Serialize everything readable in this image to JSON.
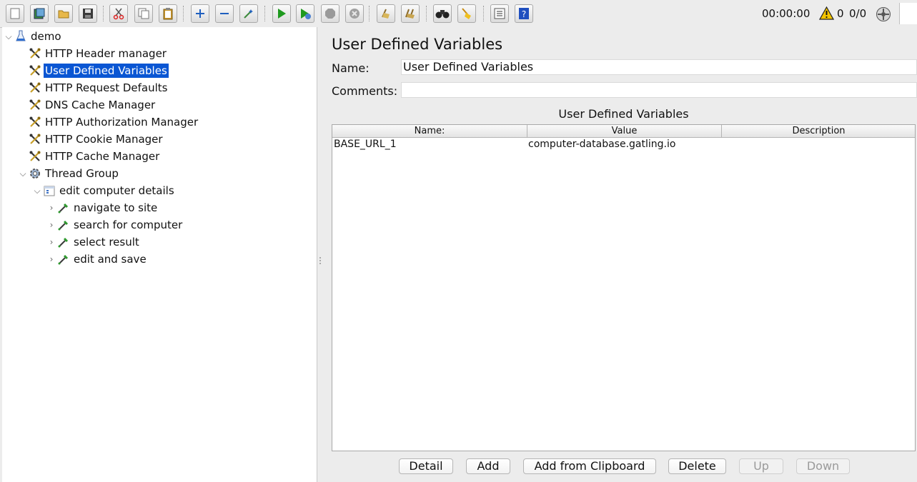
{
  "toolbar": {
    "buttons": [
      {
        "name": "new",
        "icon": "new-document-icon"
      },
      {
        "name": "templates",
        "icon": "templates-icon"
      },
      {
        "name": "open",
        "icon": "open-folder-icon"
      },
      {
        "name": "save",
        "icon": "save-disk-icon"
      },
      {
        "name": "cut",
        "icon": "scissors-icon"
      },
      {
        "name": "copy",
        "icon": "copy-icon"
      },
      {
        "name": "paste",
        "icon": "clipboard-icon"
      },
      {
        "name": "expand-all",
        "icon": "plus-icon"
      },
      {
        "name": "collapse-all",
        "icon": "minus-icon"
      },
      {
        "name": "toggle",
        "icon": "wand-icon"
      },
      {
        "name": "start",
        "icon": "play-icon"
      },
      {
        "name": "start-no-pauses",
        "icon": "play-timer-icon"
      },
      {
        "name": "stop",
        "icon": "stop-icon"
      },
      {
        "name": "shutdown",
        "icon": "shutdown-icon"
      },
      {
        "name": "clear",
        "icon": "broom-clear-icon"
      },
      {
        "name": "clear-all",
        "icon": "broom-clear-all-icon"
      },
      {
        "name": "search",
        "icon": "binoculars-icon"
      },
      {
        "name": "reset-search",
        "icon": "broom-icon"
      },
      {
        "name": "function-helper",
        "icon": "list-icon"
      },
      {
        "name": "help",
        "icon": "help-icon"
      }
    ],
    "elapsed_time": "00:00:00",
    "warning_count": "0",
    "threads": "0/0"
  },
  "tree": {
    "root": "demo",
    "config_items": [
      "HTTP Header manager",
      "User Defined Variables",
      "HTTP Request Defaults",
      "DNS Cache Manager",
      "HTTP Authorization Manager",
      "HTTP Cookie Manager",
      "HTTP Cache Manager"
    ],
    "selected_index": 1,
    "thread_group": "Thread Group",
    "controller": "edit computer details",
    "samplers": [
      "navigate to site",
      "search for computer",
      "select result",
      "edit and save"
    ]
  },
  "panel": {
    "title": "User Defined Variables",
    "name_label": "Name:",
    "name_value": "User Defined Variables",
    "comments_label": "Comments:",
    "comments_value": "",
    "table_title": "User Defined Variables",
    "columns": [
      "Name:",
      "Value",
      "Description"
    ],
    "rows": [
      {
        "name": "BASE_URL_1",
        "value": "computer-database.gatling.io",
        "description": ""
      }
    ]
  },
  "buttons": {
    "detail": "Detail",
    "add": "Add",
    "add_clipboard": "Add from Clipboard",
    "delete": "Delete",
    "up": "Up",
    "down": "Down"
  },
  "colors": {
    "selection": "#0a56d3",
    "play_green": "#1f9a1f",
    "warning_yellow": "#f3c400"
  }
}
